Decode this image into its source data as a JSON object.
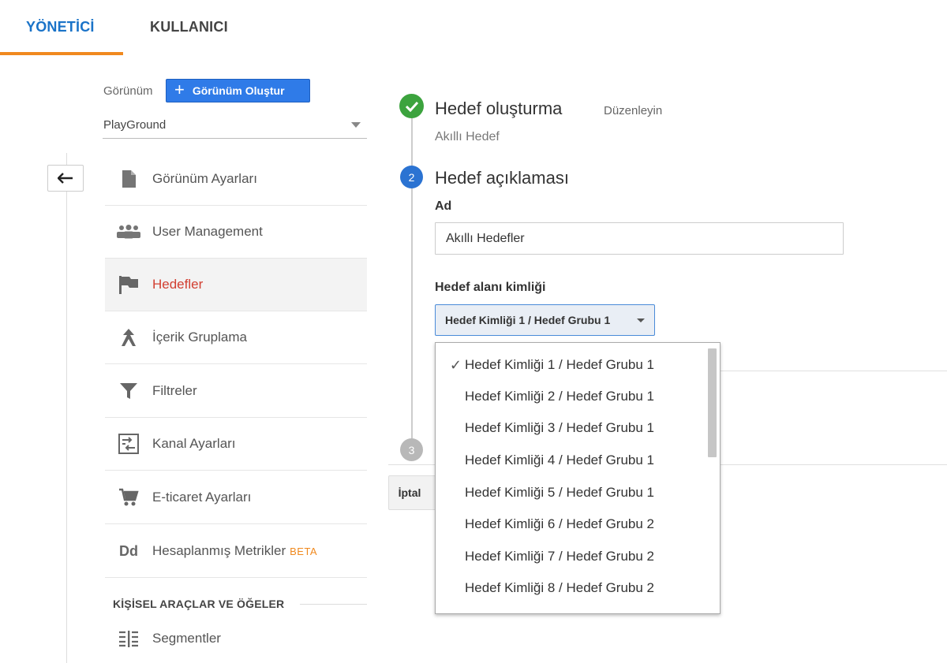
{
  "tabs": [
    {
      "label": "YÖNETİCİ",
      "active": true
    },
    {
      "label": "KULLANICI",
      "active": false
    }
  ],
  "accent_color": "#f0891e",
  "view": {
    "label": "Görünüm",
    "create_button": "Görünüm Oluştur",
    "selected": "PlayGround"
  },
  "nav": {
    "items": [
      {
        "label": "Görünüm Ayarları",
        "icon": "document-icon"
      },
      {
        "label": "User Management",
        "icon": "users-icon"
      },
      {
        "label": "Hedefler",
        "icon": "flag-icon",
        "selected": true
      },
      {
        "label": "İçerik Gruplama",
        "icon": "content-grouping-icon"
      },
      {
        "label": "Filtreler",
        "icon": "filter-icon"
      },
      {
        "label": "Kanal Ayarları",
        "icon": "channel-settings-icon"
      },
      {
        "label": "E-ticaret Ayarları",
        "icon": "cart-icon"
      },
      {
        "label": "Hesaplanmış Metrikler",
        "icon": "calculated-metrics-icon",
        "badge": "BETA"
      }
    ],
    "section_title": "KİŞİSEL ARAÇLAR VE ÖĞELER",
    "segments_label": "Segmentler"
  },
  "goal": {
    "step1_title": "Hedef oluşturma",
    "step1_edit": "Düzenleyin",
    "step1_sub": "Akıllı Hedef",
    "step2_number": "2",
    "step2_title": "Hedef açıklaması",
    "name_label": "Ad",
    "name_value": "Akıllı Hedefler",
    "slot_label": "Hedef alanı kimliği",
    "slot_selected": "Hedef Kimliği 1 / Hedef Grubu 1",
    "step3_number": "3",
    "cancel_label": "İptal"
  },
  "dropdown": {
    "options": [
      "Hedef Kimliği 1 / Hedef Grubu 1",
      "Hedef Kimliği 2 / Hedef Grubu 1",
      "Hedef Kimliği 3 / Hedef Grubu 1",
      "Hedef Kimliği 4 / Hedef Grubu 1",
      "Hedef Kimliği 5 / Hedef Grubu 1",
      "Hedef Kimliği 6 / Hedef Grubu 2",
      "Hedef Kimliği 7 / Hedef Grubu 2",
      "Hedef Kimliği 8 / Hedef Grubu 2"
    ],
    "checkmark": "✓"
  }
}
